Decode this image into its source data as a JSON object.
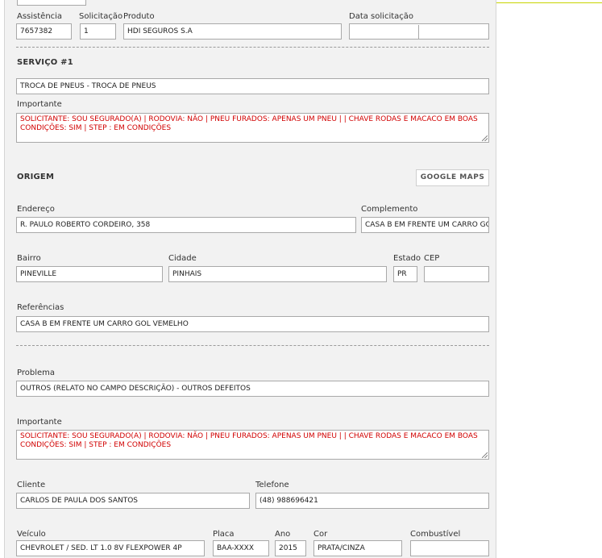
{
  "header": {
    "assistencia_label": "Assistência",
    "assistencia_value": "7657382",
    "solicitacao_label": "Solicitação",
    "solicitacao_value": "1",
    "produto_label": "Produto",
    "produto_value": "HDI SEGUROS S.A",
    "data_label": "Data solicitação",
    "data_value": ""
  },
  "servico": {
    "title": "SERVIÇO #1",
    "value": "TROCA DE PNEUS - TROCA DE PNEUS",
    "importante_label": "Importante",
    "importante_text": "SOLICITANTE: SOU SEGURADO(A) | RODOVIA: NÃO | PNEU FURADOS: APENAS UM PNEU |   | CHAVE RODAS E MACACO EM BOAS CONDIÇÕES: SIM | STEP : EM CONDIÇÕES"
  },
  "origem": {
    "title": "ORIGEM",
    "maps_button": "GOOGLE MAPS",
    "endereco_label": "Endereço",
    "endereco_value": "R. PAULO ROBERTO CORDEIRO, 358",
    "complemento_label": "Complemento",
    "complemento_value": "CASA B EM FRENTE UM CARRO GOL VELHO",
    "bairro_label": "Bairro",
    "bairro_value": "PINEVILLE",
    "cidade_label": "Cidade",
    "cidade_value": "PINHAIS",
    "estado_label": "Estado",
    "estado_value": "PR",
    "cep_label": "CEP",
    "cep_value": "",
    "referencias_label": "Referências",
    "referencias_value": "CASA B EM FRENTE UM CARRO GOL VEMELHO"
  },
  "detalhes": {
    "problema_label": "Problema",
    "problema_value": "OUTROS (RELATO NO CAMPO DESCRIÇÃO) - OUTROS DEFEITOS",
    "importante_label": "Importante",
    "importante_text": "SOLICITANTE: SOU SEGURADO(A) | RODOVIA: NÃO | PNEU FURADOS: APENAS UM PNEU |   | CHAVE RODAS E MACACO EM BOAS CONDIÇÕES: SIM | STEP : EM CONDIÇÕES",
    "cliente_label": "Cliente",
    "cliente_value": "CARLOS DE PAULA DOS SANTOS",
    "telefone_label": "Telefone",
    "telefone_value": "(48) 988696421",
    "veiculo_label": "Veículo",
    "veiculo_value": "CHEVROLET / SED. LT 1.0 8V FLEXPOWER 4P",
    "placa_label": "Placa",
    "placa_value": "BAA-XXXX",
    "ano_label": "Ano",
    "ano_value": "2015",
    "cor_label": "Cor",
    "cor_value": "PRATA/CINZA",
    "combustivel_label": "Combustível",
    "combustivel_value": ""
  },
  "colors": {
    "panel": "#f2f2f2",
    "alert_text": "#d10000",
    "accent_line": "#c8d400"
  }
}
